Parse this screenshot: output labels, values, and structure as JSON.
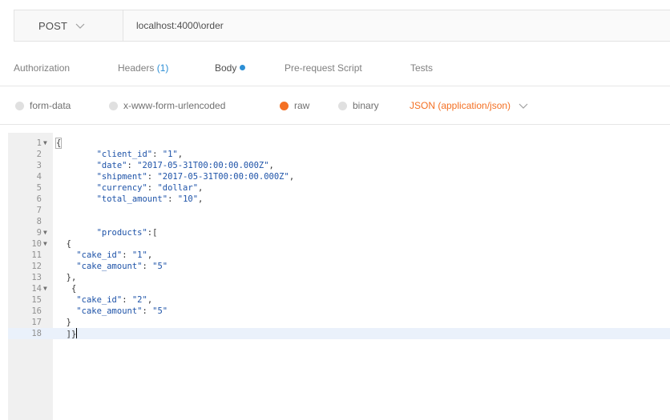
{
  "request": {
    "method": "POST",
    "url": "localhost:4000\\order"
  },
  "tabs": [
    {
      "label": "Authorization"
    },
    {
      "label": "Headers",
      "count": "(1)"
    },
    {
      "label": "Body"
    },
    {
      "label": "Pre-request Script"
    },
    {
      "label": "Tests"
    }
  ],
  "body_options": {
    "form_data": "form-data",
    "urlencoded": "x-www-form-urlencoded",
    "raw": "raw",
    "binary": "binary",
    "content_type": "JSON (application/json)"
  },
  "editor": {
    "lines": [
      {
        "n": "1",
        "fold": true
      },
      {
        "n": "2"
      },
      {
        "n": "3"
      },
      {
        "n": "4"
      },
      {
        "n": "5"
      },
      {
        "n": "6"
      },
      {
        "n": "7"
      },
      {
        "n": "8"
      },
      {
        "n": "9",
        "fold": true
      },
      {
        "n": "10",
        "fold": true
      },
      {
        "n": "11"
      },
      {
        "n": "12"
      },
      {
        "n": "13"
      },
      {
        "n": "14",
        "fold": true
      },
      {
        "n": "15"
      },
      {
        "n": "16"
      },
      {
        "n": "17"
      },
      {
        "n": "18"
      }
    ],
    "code": {
      "l1": "{",
      "l2_key": "\"client_id\"",
      "l2_val": "\"1\"",
      "l3_key": "\"date\"",
      "l3_val": "\"2017-05-31T00:00:00.000Z\"",
      "l4_key": "\"shipment\"",
      "l4_val": "\"2017-05-31T00:00:00.000Z\"",
      "l5_key": "\"currency\"",
      "l5_val": "\"dollar\"",
      "l6_key": "\"total_amount\"",
      "l6_val": "\"10\"",
      "l9_key": "\"products\"",
      "l11_key": "\"cake_id\"",
      "l11_val": "\"1\"",
      "l12_key": "\"cake_amount\"",
      "l12_val": "\"5\"",
      "l15_key": "\"cake_id\"",
      "l15_val": "\"2\"",
      "l16_key": "\"cake_amount\"",
      "l16_val": "\"5\"",
      "l18": "]}"
    }
  }
}
